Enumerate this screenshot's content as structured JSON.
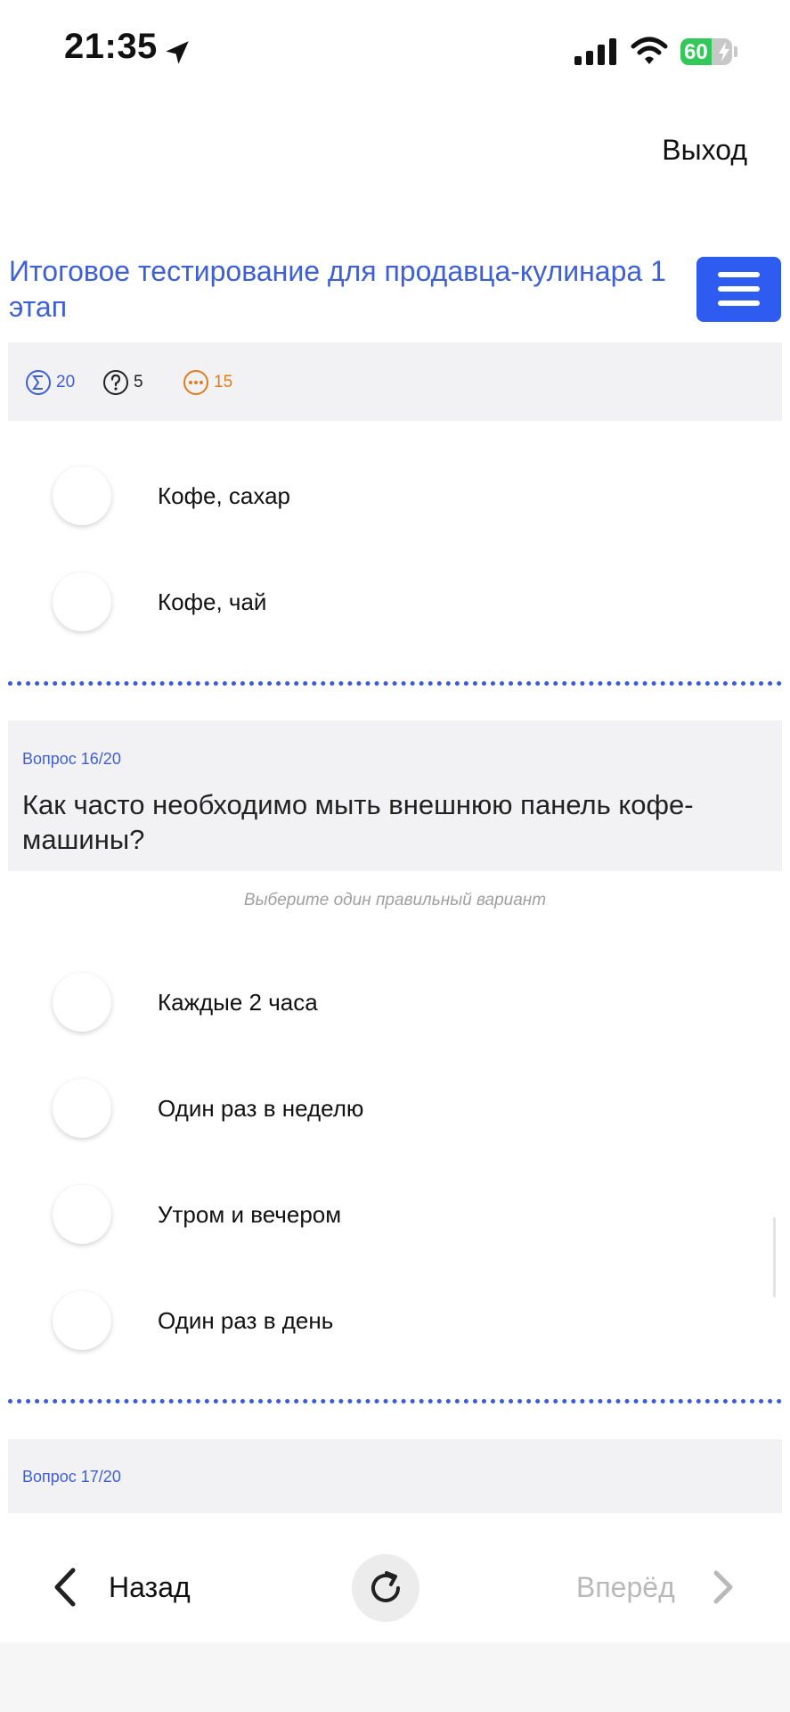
{
  "status_bar": {
    "time": "21:35",
    "battery": "60",
    "battery_level": 0.6
  },
  "header": {
    "exit_label": "Выход"
  },
  "test": {
    "title": "Итоговое тестирование для продавца-кулинара 1 этап"
  },
  "stats": {
    "total": "20",
    "answered": "5",
    "remaining": "15"
  },
  "previous_question": {
    "options": [
      "Кофе, сахар",
      "Кофе, чай"
    ]
  },
  "question_16": {
    "number": "Вопрос 16/20",
    "text": "Как часто необходимо мыть внешнюю панель кофе-машины?",
    "hint": "Выберите один правильный вариант",
    "options": [
      "Каждые 2 часа",
      "Один раз в неделю",
      "Утром и вечером",
      "Один раз в день"
    ]
  },
  "question_17": {
    "number": "Вопрос 17/20"
  },
  "nav": {
    "back_label": "Назад",
    "next_label": "Вперёд"
  },
  "colors": {
    "accent": "#3f5fd6",
    "menu_button": "#2f5cf0",
    "battery_green": "#34c759",
    "orange": "#e07b20"
  }
}
